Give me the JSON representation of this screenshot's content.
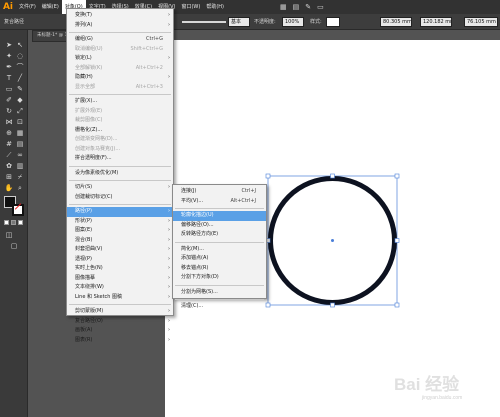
{
  "menubar": {
    "logo": "Ai",
    "items": [
      "文件(F)",
      "编辑(E)",
      "对象(O)",
      "文字(T)",
      "选择(S)",
      "效果(C)",
      "视图(V)",
      "窗口(W)",
      "帮助(H)"
    ],
    "active_index": 2
  },
  "control_bar": {
    "left_label": "复合路径",
    "stroke_style_label": "基本",
    "opacity_label": "不透明度:",
    "opacity_value": "100%",
    "style_label": "样式:",
    "x_value": "80.305 mm",
    "y_value": "120.182 mm",
    "w_value": "76.105 mm"
  },
  "document_tab": "未标题-1* @ 1...",
  "object_menu": {
    "items": [
      {
        "label": "变换(T)",
        "submenu": true
      },
      {
        "label": "排列(A)",
        "submenu": true
      },
      {
        "sep": true
      },
      {
        "label": "编组(G)",
        "shortcut": "Ctrl+G"
      },
      {
        "label": "取消编组(U)",
        "shortcut": "Shift+Ctrl+G",
        "disabled": true
      },
      {
        "label": "锁定(L)",
        "submenu": true
      },
      {
        "label": "全部解锁(K)",
        "shortcut": "Alt+Ctrl+2",
        "disabled": true
      },
      {
        "label": "隐藏(H)",
        "submenu": true
      },
      {
        "label": "显示全部",
        "shortcut": "Alt+Ctrl+3",
        "disabled": true
      },
      {
        "sep": true
      },
      {
        "label": "扩展(X)..."
      },
      {
        "label": "扩展外观(E)",
        "disabled": true
      },
      {
        "label": "裁剪图像(C)",
        "disabled": true
      },
      {
        "label": "栅格化(Z)..."
      },
      {
        "label": "创建渐变网格(D)...",
        "disabled": true
      },
      {
        "label": "创建对象马赛克(J)...",
        "disabled": true
      },
      {
        "label": "拼合透明度(F)..."
      },
      {
        "sep": true
      },
      {
        "label": "设为像素级优化(M)"
      },
      {
        "sep": true
      },
      {
        "label": "切片(S)",
        "submenu": true
      },
      {
        "label": "创建裁切标记(C)"
      },
      {
        "sep": true
      },
      {
        "label": "路径(P)",
        "submenu": true,
        "highlight": true
      },
      {
        "label": "形状(P)",
        "submenu": true
      },
      {
        "label": "图案(E)",
        "submenu": true
      },
      {
        "label": "混合(B)",
        "submenu": true
      },
      {
        "label": "封套扭曲(V)",
        "submenu": true
      },
      {
        "label": "透视(P)",
        "submenu": true
      },
      {
        "label": "实时上色(N)",
        "submenu": true
      },
      {
        "label": "图像描摹",
        "submenu": true
      },
      {
        "label": "文本绕排(W)",
        "submenu": true
      },
      {
        "label": "Line 和 Sketch 图稿",
        "submenu": true
      },
      {
        "sep": true
      },
      {
        "label": "剪切蒙版(M)",
        "submenu": true
      },
      {
        "label": "复合路径(O)",
        "submenu": true
      },
      {
        "label": "画板(A)",
        "submenu": true
      },
      {
        "label": "图表(R)",
        "submenu": true
      }
    ]
  },
  "path_submenu": {
    "items": [
      {
        "label": "连接(J)",
        "shortcut": "Ctrl+J"
      },
      {
        "label": "平均(V)...",
        "shortcut": "Alt+Ctrl+J"
      },
      {
        "sep": true
      },
      {
        "label": "轮廓化描边(U)",
        "highlight": true
      },
      {
        "label": "偏移路径(O)..."
      },
      {
        "label": "反转路径方向(E)"
      },
      {
        "sep": true
      },
      {
        "label": "简化(M)..."
      },
      {
        "label": "添加锚点(A)"
      },
      {
        "label": "移去锚点(R)"
      },
      {
        "label": "分割下方对象(D)"
      },
      {
        "sep": true
      },
      {
        "label": "分割为网格(S)..."
      },
      {
        "sep": true
      },
      {
        "label": "清理(C)..."
      }
    ]
  },
  "canvas": {
    "shape": "circle-ring",
    "stroke_color": "#0d1220",
    "selection_color": "#4a7fd8"
  },
  "watermark": {
    "text": "Bai 经验",
    "sub": "jingyan.baidu.com"
  },
  "colors": {
    "menu_highlight": "#5aa0e6",
    "accent_logo": "#ff9a00"
  }
}
